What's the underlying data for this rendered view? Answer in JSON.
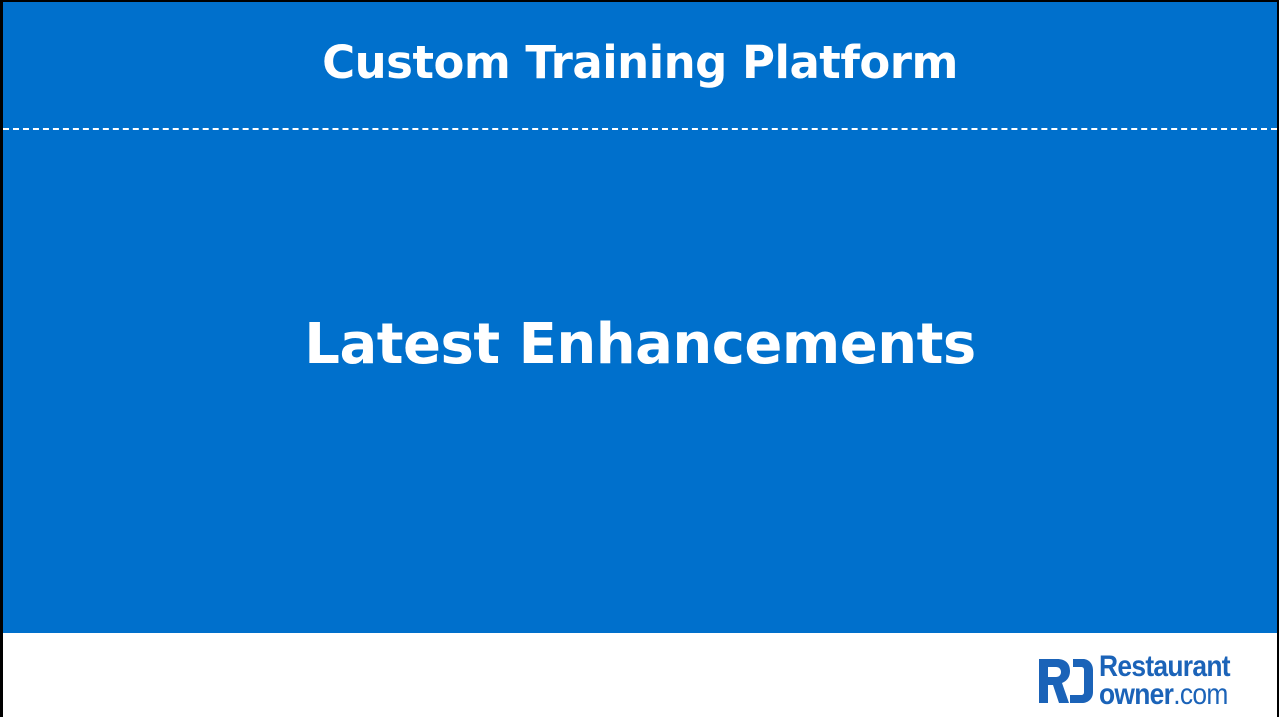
{
  "slide": {
    "header_title": "Custom Training Platform",
    "main_title": "Latest Enhancements",
    "background_color": "#0070cc",
    "text_color": "#ffffff"
  },
  "logo": {
    "line1": "Restaurant",
    "line2_bold": "owner",
    "line2_suffix": ".com",
    "mark_icon": "ro-monogram-icon",
    "brand_color": "#1b63b8"
  }
}
